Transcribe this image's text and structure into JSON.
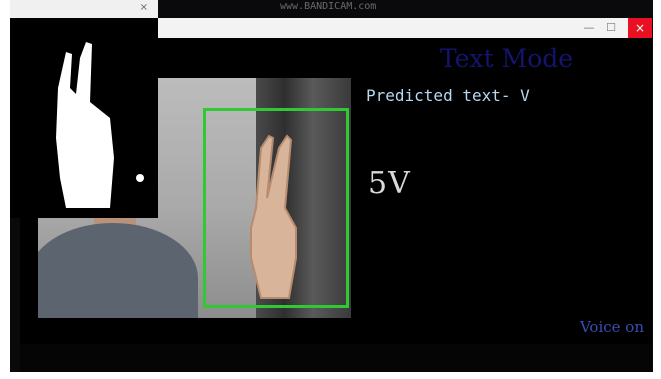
{
  "browser": {
    "url_text": "www.BANDICAM.com"
  },
  "mask_window": {
    "title": "",
    "close": "×"
  },
  "main_window": {
    "minimize": "—",
    "maximize": "☐",
    "close": "×",
    "mode_title": "Text Mode",
    "predicted_text": "Predicted text- V",
    "result_text": "5V",
    "voice_status": "Voice on"
  },
  "console": {
    "left_text": "",
    "lines": [
      "",
      ""
    ]
  },
  "colors": {
    "desktop_bg": "#0a0a0c",
    "roi_border": "#31c931",
    "mode_title": "#14146e",
    "voice_status": "#3b4cb5",
    "predicted_text": "#b7d8ef",
    "close_button": "#e81123"
  }
}
